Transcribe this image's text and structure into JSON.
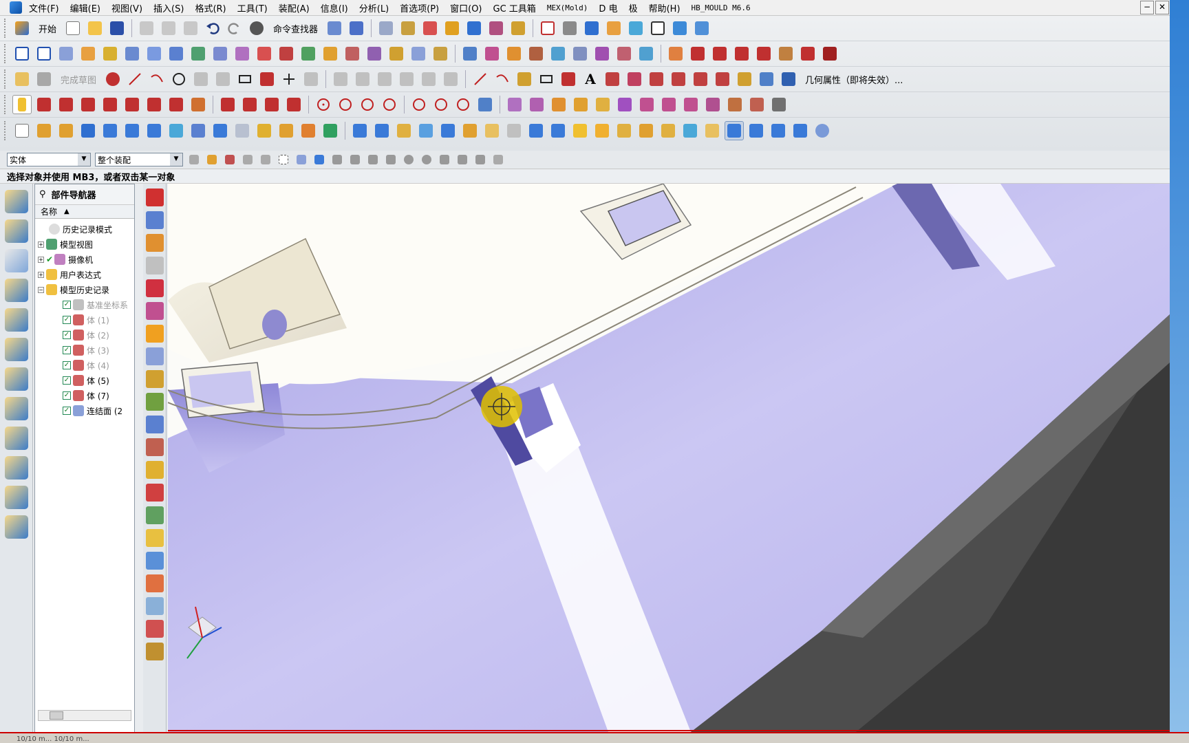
{
  "menubar": {
    "items": [
      "文件(F)",
      "编辑(E)",
      "视图(V)",
      "插入(S)",
      "格式(R)",
      "工具(T)",
      "装配(A)",
      "信息(I)",
      "分析(L)",
      "首选项(P)",
      "窗口(O)",
      "GC 工具箱",
      "MEX(Mold)",
      "D 电",
      "极",
      "帮助(H)",
      "HB_MOULD M6.6"
    ]
  },
  "toolbar": {
    "start_label": "开始",
    "cmd_finder_label": "命令查找器",
    "finish_sketch_label": "完成草图",
    "geom_props_label": "几何属性（即将失效）..."
  },
  "filter": {
    "type_filter": "实体",
    "scope_filter": "整个装配"
  },
  "cue": {
    "text": "选择对象并使用 MB3，或者双击某一对象"
  },
  "navigator": {
    "title": "部件导航器",
    "column_name": "名称",
    "nodes": [
      {
        "label": "历史记录模式",
        "level": 0
      },
      {
        "label": "模型视图",
        "level": 0
      },
      {
        "label": "摄像机",
        "level": 0
      },
      {
        "label": "用户表达式",
        "level": 0
      },
      {
        "label": "模型历史记录",
        "level": 0
      },
      {
        "label": "基准坐标系",
        "level": 1
      },
      {
        "label": "体 (1)",
        "level": 1
      },
      {
        "label": "体 (2)",
        "level": 1
      },
      {
        "label": "体 (3)",
        "level": 1
      },
      {
        "label": "体 (4)",
        "level": 1
      },
      {
        "label": "体 (5)",
        "level": 1
      },
      {
        "label": "体 (7)",
        "level": 1
      },
      {
        "label": "连结面 (2",
        "level": 1
      }
    ]
  },
  "colors": {
    "model_face": "#c9c6f0",
    "model_shadow": "#6c68a0",
    "background_dark": "#3f3f3f",
    "highlight": "#f0d000"
  },
  "statusbar": {
    "text": "10/10 m... 10/10 m..."
  }
}
